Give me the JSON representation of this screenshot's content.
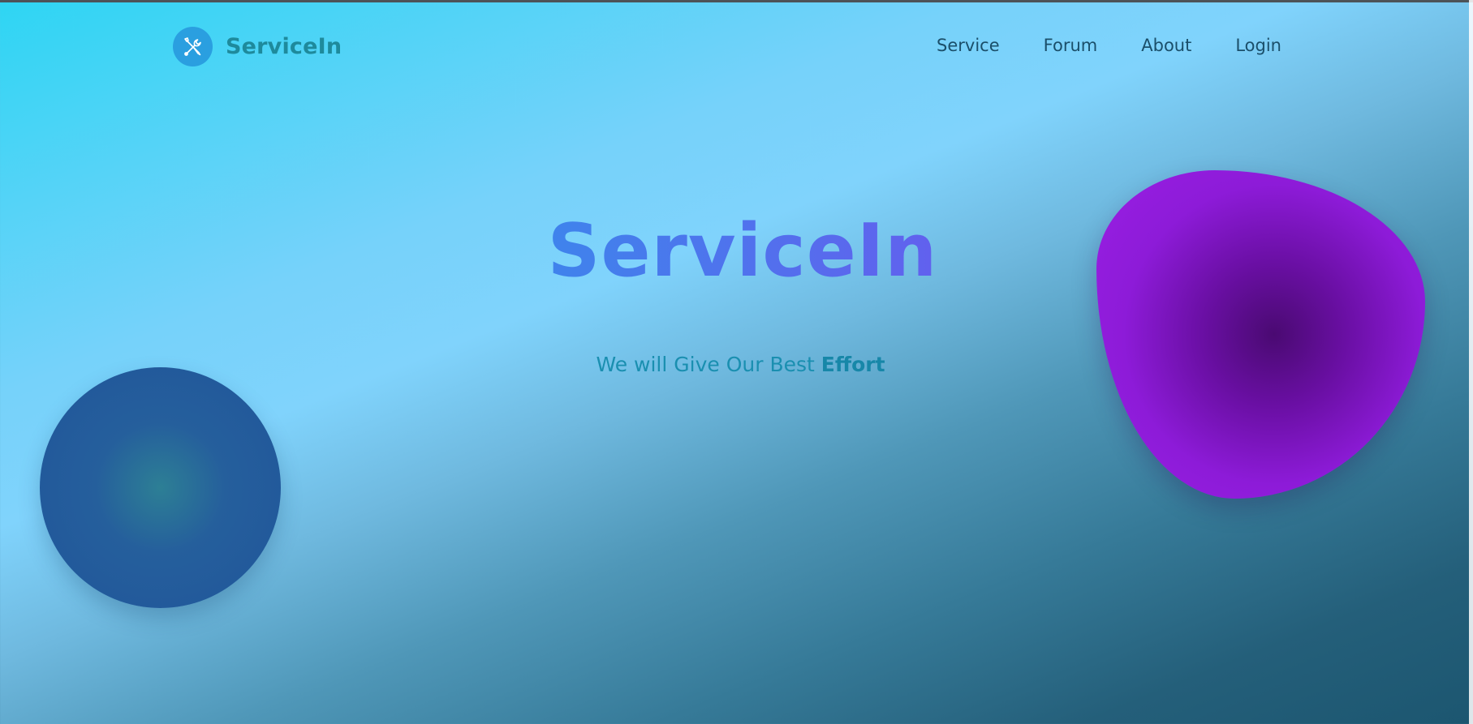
{
  "brand": {
    "name": "ServiceIn",
    "logo_icon": "tools-icon"
  },
  "nav": {
    "items": [
      {
        "label": "Service"
      },
      {
        "label": "Forum"
      },
      {
        "label": "About"
      },
      {
        "label": "Login"
      }
    ]
  },
  "hero": {
    "title": "ServiceIn",
    "subtitle_prefix": "We will Give Our Best ",
    "subtitle_emphasis": "Effort"
  },
  "colors": {
    "brand_text": "#1e8a9c",
    "nav_text": "#1b4f6a",
    "title_gradient_start": "#1fa1e9",
    "title_gradient_end": "#7b47ec",
    "subtitle": "#1a8fb0",
    "circle_blob": "#20559a",
    "purple_blob": "#9a1fe4"
  }
}
